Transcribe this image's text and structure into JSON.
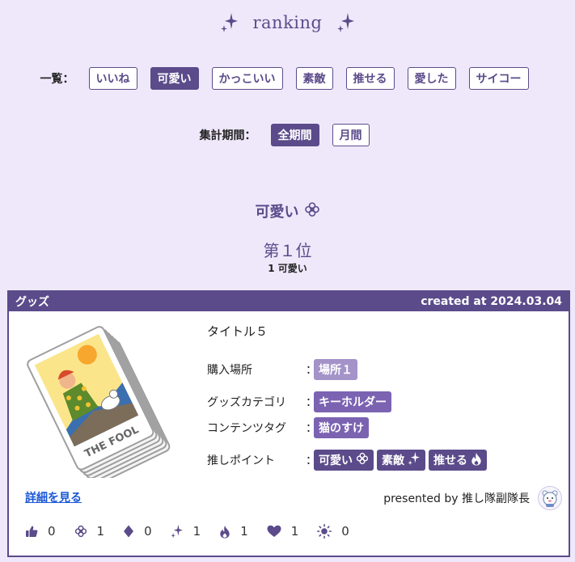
{
  "header": {
    "title": "ranking"
  },
  "filters": {
    "list_label": "一覧：",
    "categories": [
      {
        "label": "いいね",
        "active": false
      },
      {
        "label": "可愛い",
        "active": true
      },
      {
        "label": "かっこいい",
        "active": false
      },
      {
        "label": "素敵",
        "active": false
      },
      {
        "label": "推せる",
        "active": false
      },
      {
        "label": "愛した",
        "active": false
      },
      {
        "label": "サイコー",
        "active": false
      }
    ],
    "period_label": "集計期間：",
    "periods": [
      {
        "label": "全期間",
        "active": true
      },
      {
        "label": "月間",
        "active": false
      }
    ]
  },
  "section": {
    "heading": "可愛い",
    "heading_icon": "flower-icon",
    "rank": "第１位",
    "rank_sub": "1 可愛い"
  },
  "card": {
    "type_label": "グッズ",
    "created_at": "created at 2024.03.04",
    "item_title": "タイトル５",
    "image_alt": "tarot-card-the-fool-illustration",
    "image_text": "THE FOOL",
    "fields": {
      "place_label": "購入場所",
      "place_value": "場所１",
      "category_label": "グッズカテゴリ",
      "category_value": "キーホルダー",
      "content_label": "コンテンツタグ",
      "content_value": "猫のすけ",
      "points_label": "推しポイント",
      "points": [
        {
          "label": "可愛い",
          "icon": "flower-icon"
        },
        {
          "label": "素敵",
          "icon": "sparkle-icon"
        },
        {
          "label": "推せる",
          "icon": "flame-icon"
        }
      ],
      "colon": "："
    },
    "detail_link": "詳細を見る",
    "presented_by": "presented by 推し隊副隊長",
    "avatar_icon": "bear-avatar-icon"
  },
  "reactions": [
    {
      "icon": "thumbs-up-icon",
      "count": "0"
    },
    {
      "icon": "flower-icon",
      "count": "1"
    },
    {
      "icon": "diamond-icon",
      "count": "0"
    },
    {
      "icon": "sparkle-icon",
      "count": "1"
    },
    {
      "icon": "flame-icon",
      "count": "1"
    },
    {
      "icon": "heart-icon",
      "count": "1"
    },
    {
      "icon": "sun-icon",
      "count": "0"
    }
  ],
  "colors": {
    "accent": "#5b4b8a",
    "background": "#efe8fb",
    "tag_light": "#a493c9",
    "tag_mid": "#7b63b2",
    "link": "#1a56d6"
  }
}
